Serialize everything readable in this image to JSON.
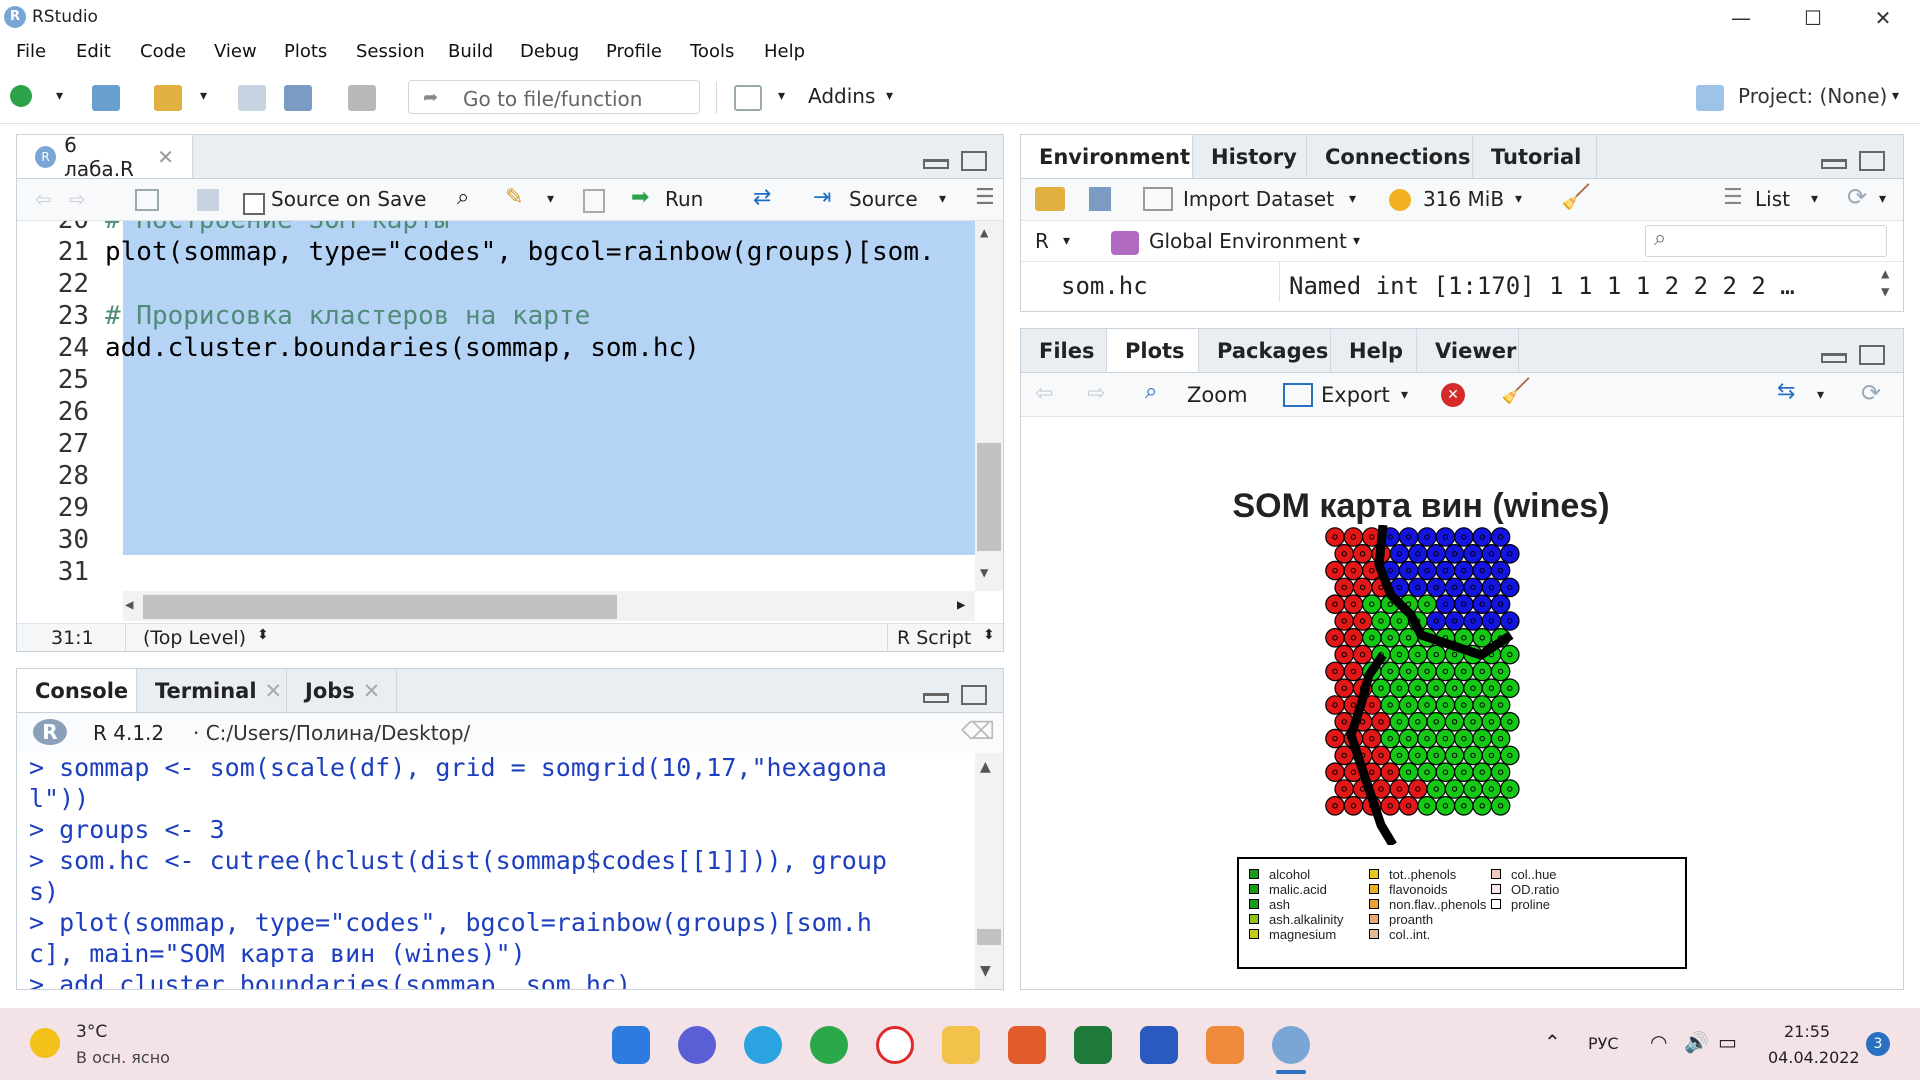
{
  "window": {
    "title": "RStudio",
    "minimize": "—",
    "maximize": "☐",
    "close": "✕"
  },
  "menu": [
    "File",
    "Edit",
    "Code",
    "View",
    "Plots",
    "Session",
    "Build",
    "Debug",
    "Profile",
    "Tools",
    "Help"
  ],
  "toolbar": {
    "goto_placeholder": "Go to file/function",
    "addins": "Addins",
    "project": "Project: (None)"
  },
  "editor": {
    "tab_label": "6 лаба.R",
    "source_on_save": "Source on Save",
    "run": "Run",
    "source": "Source",
    "top_partial": "# Построение SOM карты",
    "lines": [
      {
        "n": "21",
        "text": "plot(sommap, type=\"codes\", bgcol=rainbow(groups)[som."
      },
      {
        "n": "22",
        "text": ""
      },
      {
        "n": "23",
        "text": "# Прорисовка кластеров на карте"
      },
      {
        "n": "24",
        "text": "add.cluster.boundaries(sommap, som.hc)"
      },
      {
        "n": "25",
        "text": ""
      },
      {
        "n": "26",
        "text": ""
      },
      {
        "n": "27",
        "text": ""
      },
      {
        "n": "28",
        "text": ""
      },
      {
        "n": "29",
        "text": ""
      },
      {
        "n": "30",
        "text": ""
      },
      {
        "n": "31",
        "text": ""
      }
    ],
    "status_pos": "31:1",
    "status_scope": "(Top Level)",
    "status_type": "R Script"
  },
  "console": {
    "tabs": [
      "Console",
      "Terminal",
      "Jobs"
    ],
    "version": "R 4.1.2",
    "path": "· C:/Users/Полина/Desktop/",
    "lines": [
      "> sommap <- som(scale(df), grid = somgrid(10,17,\"hexagona",
      "l\"))",
      "> groups <- 3",
      "> som.hc <- cutree(hclust(dist(sommap$codes[[1]])), group",
      "s)",
      "> plot(sommap, type=\"codes\", bgcol=rainbow(groups)[som.h",
      "c], main=\"SOM карта вин (wines)\")",
      "> add.cluster.boundaries(sommap, som.hc)"
    ]
  },
  "environment": {
    "tabs": [
      "Environment",
      "History",
      "Connections",
      "Tutorial"
    ],
    "import": "Import Dataset",
    "memory": "316 MiB",
    "list": "List",
    "lang": "R",
    "scope": "Global Environment",
    "var_name": "som.hc",
    "var_value": "Named int [1:170] 1 1 1 1 2 2 2 2 …"
  },
  "files": {
    "tabs": [
      "Files",
      "Plots",
      "Packages",
      "Help",
      "Viewer"
    ],
    "zoom": "Zoom",
    "export": "Export"
  },
  "plot": {
    "title": "SOM карта вин (wines)",
    "legend": [
      {
        "label": "alcohol",
        "color": "#1a9a1a"
      },
      {
        "label": "malic.acid",
        "color": "#1a9a1a"
      },
      {
        "label": "ash",
        "color": "#1a9a1a"
      },
      {
        "label": "ash.alkalinity",
        "color": "#8cc21a"
      },
      {
        "label": "magnesium",
        "color": "#c8c81a"
      },
      {
        "label": "tot..phenols",
        "color": "#e8c81a"
      },
      {
        "label": "flavonoids",
        "color": "#e8b020"
      },
      {
        "label": "non.flav..phenols",
        "color": "#e8a030"
      },
      {
        "label": "proanth",
        "color": "#e8a870"
      },
      {
        "label": "col..int.",
        "color": "#e8b890"
      },
      {
        "label": "col..hue",
        "color": "#f0c8c0"
      },
      {
        "label": "OD.ratio",
        "color": "#f6e8e8"
      },
      {
        "label": "proline",
        "color": "#ffffff"
      }
    ]
  },
  "taskbar": {
    "weather_temp": "3°C",
    "weather_desc": "В осн. ясно",
    "lang": "РУС",
    "time": "21:55",
    "date": "04.04.2022",
    "badge": "3"
  }
}
